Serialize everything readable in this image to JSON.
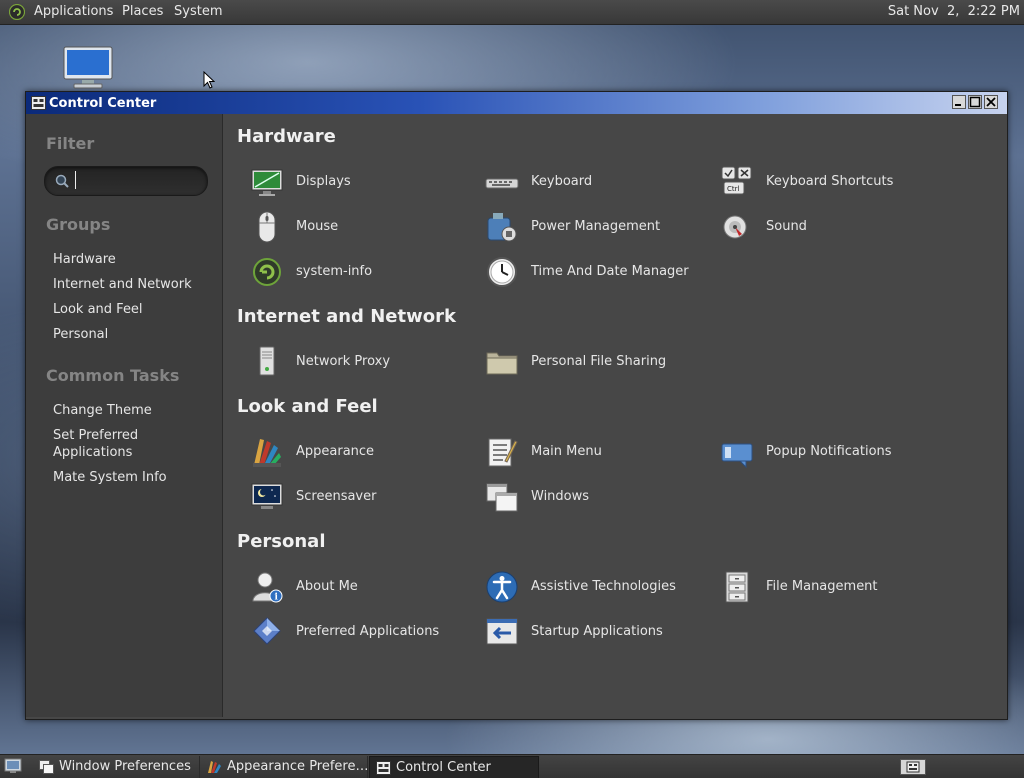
{
  "top_panel": {
    "menus": [
      "Applications",
      "Places",
      "System"
    ],
    "clock": "Sat Nov  2,  2:22 PM"
  },
  "window": {
    "title": "Control Center"
  },
  "sidebar": {
    "filter_heading": "Filter",
    "search_value": "",
    "groups_heading": "Groups",
    "groups": [
      "Hardware",
      "Internet and Network",
      "Look and Feel",
      "Personal"
    ],
    "tasks_heading": "Common Tasks",
    "tasks": [
      "Change Theme",
      "Set Preferred\nApplications",
      "Mate System Info"
    ]
  },
  "sections": [
    {
      "title": "Hardware",
      "items": [
        {
          "label": "Displays",
          "icon": "display-icon"
        },
        {
          "label": "Keyboard",
          "icon": "keyboard-icon"
        },
        {
          "label": "Keyboard Shortcuts",
          "icon": "keyboard-shortcuts-icon"
        },
        {
          "label": "Mouse",
          "icon": "mouse-icon"
        },
        {
          "label": "Power Management",
          "icon": "power-management-icon"
        },
        {
          "label": "Sound",
          "icon": "sound-icon"
        },
        {
          "label": "system-info",
          "icon": "system-info-icon"
        },
        {
          "label": "Time And Date Manager",
          "icon": "clock-icon"
        }
      ]
    },
    {
      "title": "Internet and Network",
      "items": [
        {
          "label": "Network Proxy",
          "icon": "network-proxy-icon"
        },
        {
          "label": "Personal File Sharing",
          "icon": "folder-share-icon"
        }
      ]
    },
    {
      "title": "Look and Feel",
      "items": [
        {
          "label": "Appearance",
          "icon": "appearance-icon"
        },
        {
          "label": "Main Menu",
          "icon": "main-menu-icon"
        },
        {
          "label": "Popup Notifications",
          "icon": "notification-icon"
        },
        {
          "label": "Screensaver",
          "icon": "screensaver-icon"
        },
        {
          "label": "Windows",
          "icon": "windows-icon"
        }
      ]
    },
    {
      "title": "Personal",
      "items": [
        {
          "label": "About Me",
          "icon": "about-me-icon"
        },
        {
          "label": "Assistive Technologies",
          "icon": "accessibility-icon"
        },
        {
          "label": "File Management",
          "icon": "file-cabinet-icon"
        },
        {
          "label": "Preferred Applications",
          "icon": "preferred-apps-icon"
        },
        {
          "label": "Startup Applications",
          "icon": "startup-apps-icon"
        }
      ]
    }
  ],
  "taskbar": {
    "tasks": [
      {
        "label": "Window Preferences",
        "active": false
      },
      {
        "label": "Appearance Prefere…",
        "active": false
      },
      {
        "label": "Control Center",
        "active": true
      }
    ]
  }
}
